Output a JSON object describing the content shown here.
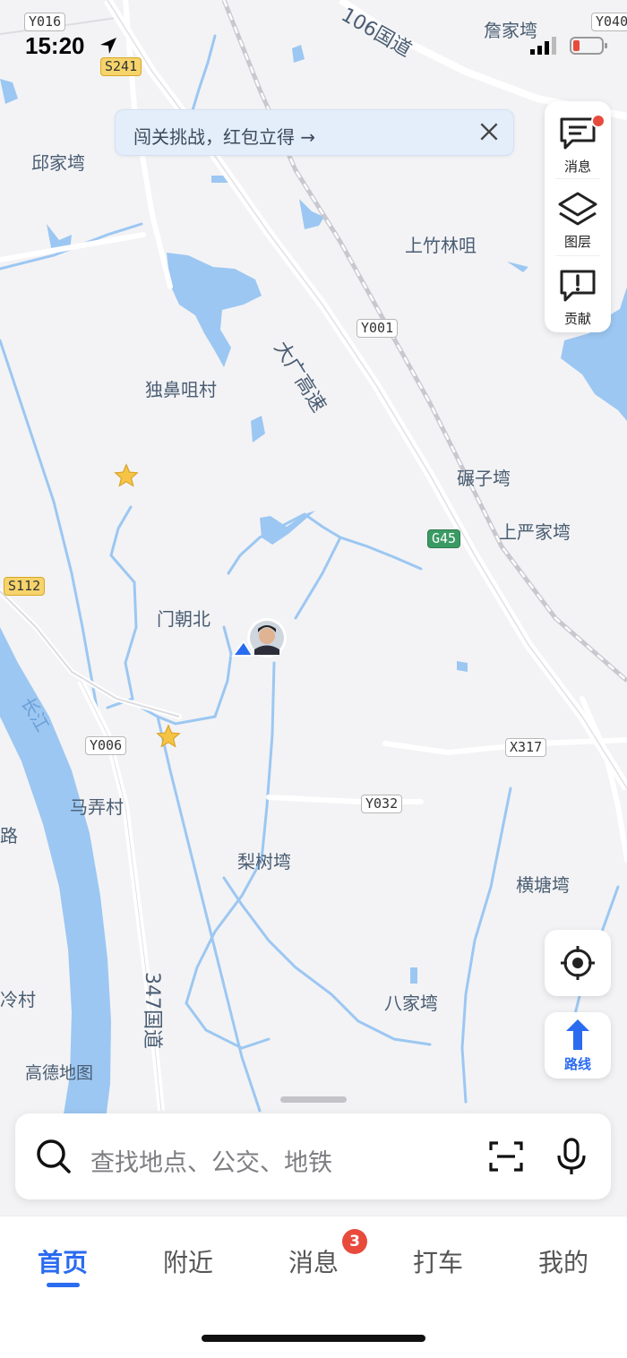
{
  "status_bar": {
    "time": "15:20"
  },
  "map": {
    "place_labels": [
      "邱家塆",
      "上竹林咀",
      "独鼻咀村",
      "碾子塆",
      "上严家塆",
      "门朝北",
      "马弄村",
      "梨树塆",
      "横塘塆",
      "八家塆",
      "詹家塆",
      "路",
      "冷村"
    ],
    "road_names": {
      "expressway": "大广高速",
      "national_106": "106国道",
      "national_347": "347国道"
    },
    "river_label": "长江",
    "road_shields": [
      "Y016",
      "S241",
      "Y040",
      "Y001",
      "G45",
      "S112",
      "Y006",
      "X317",
      "Y032"
    ],
    "attribution": "高德地图"
  },
  "banner": {
    "text": "闯关挑战，红包立得 →"
  },
  "side_panel": {
    "items": [
      "消息",
      "图层",
      "贡献"
    ]
  },
  "route_button": {
    "label": "路线"
  },
  "search": {
    "placeholder": "查找地点、公交、地铁"
  },
  "tabs": [
    {
      "label": "首页",
      "active": true
    },
    {
      "label": "附近"
    },
    {
      "label": "消息",
      "badge": "3"
    },
    {
      "label": "打车"
    },
    {
      "label": "我的"
    }
  ],
  "colors": {
    "accent": "#2a6bf0",
    "water": "#9cc7f2",
    "badge": "#e84a3c",
    "map_bg": "#f3f3f5"
  }
}
